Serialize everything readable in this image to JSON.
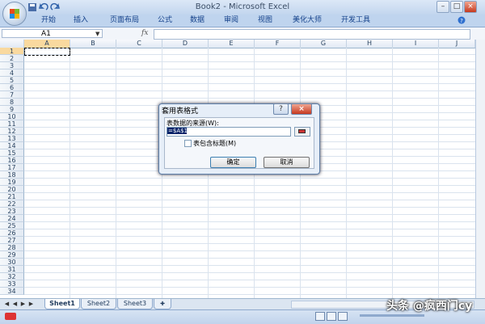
{
  "window": {
    "title": "Book2 - Microsoft Excel",
    "controls": [
      "–",
      "□",
      "×"
    ]
  },
  "ribbon": {
    "tabs": [
      "开始",
      "插入",
      "页面布局",
      "公式",
      "数据",
      "审阅",
      "视图",
      "美化大师",
      "开发工具"
    ]
  },
  "formula_bar": {
    "name_box": "A1",
    "fx": "fx",
    "value": ""
  },
  "grid": {
    "columns": [
      "A",
      "B",
      "C",
      "D",
      "E",
      "F",
      "G",
      "H",
      "I",
      "J"
    ],
    "rows": [
      "1",
      "2",
      "3",
      "4",
      "5",
      "6",
      "7",
      "8",
      "9",
      "10",
      "11",
      "12",
      "13",
      "14",
      "15",
      "16",
      "17",
      "18",
      "19",
      "20",
      "21",
      "22",
      "23",
      "24",
      "25",
      "26",
      "27",
      "28",
      "29",
      "30",
      "31",
      "32",
      "33",
      "34"
    ],
    "selected_cell": "A1"
  },
  "sheets": {
    "tabs": [
      "Sheet1",
      "Sheet2",
      "Sheet3"
    ],
    "active": "Sheet1"
  },
  "dialog": {
    "title": "套用表格式",
    "help": "?",
    "close": "×",
    "source_label": "表数据的来源(W):",
    "source_value": "=$A$1",
    "checkbox_label": "表包含标题(M)",
    "checkbox_checked": false,
    "ok": "确定",
    "cancel": "取消"
  },
  "watermark": "头条 @疯西门cy",
  "colors": {
    "accent": "#15428b",
    "frame": "#c2d6ee"
  }
}
